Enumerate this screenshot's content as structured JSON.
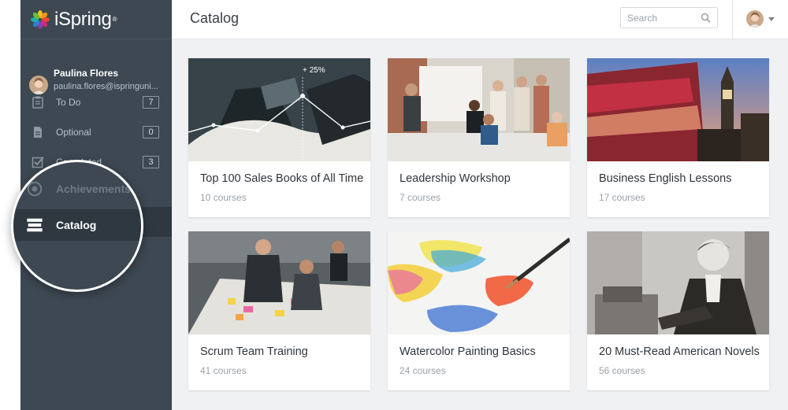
{
  "brand": {
    "name": "iSpring",
    "reg": "®"
  },
  "user": {
    "name": "Paulina Flores",
    "email": "paulina.flores@ispringuni..."
  },
  "nav": [
    {
      "label": "To Do",
      "count": "7",
      "icon": "clipboard-icon"
    },
    {
      "label": "Optional",
      "count": "0",
      "icon": "document-icon"
    },
    {
      "label": "Completed",
      "count": "3",
      "icon": "checkbox-icon"
    },
    {
      "label": "Achievements",
      "icon": "badge-icon"
    },
    {
      "label": "Catalog",
      "icon": "books-icon"
    }
  ],
  "header": {
    "title": "Catalog",
    "search_placeholder": "Search"
  },
  "cards": [
    {
      "title": "Top 100 Sales Books of All Time",
      "sub": "10 courses",
      "image_label": "+ 25%"
    },
    {
      "title": "Leadership Workshop",
      "sub": "7 courses"
    },
    {
      "title": "Business English Lessons",
      "sub": "17 courses"
    },
    {
      "title": "Scrum Team Training",
      "sub": "41 courses"
    },
    {
      "title": "Watercolor Painting Basics",
      "sub": "24 courses"
    },
    {
      "title": "20 Must-Read American Novels",
      "sub": "56 courses"
    }
  ]
}
